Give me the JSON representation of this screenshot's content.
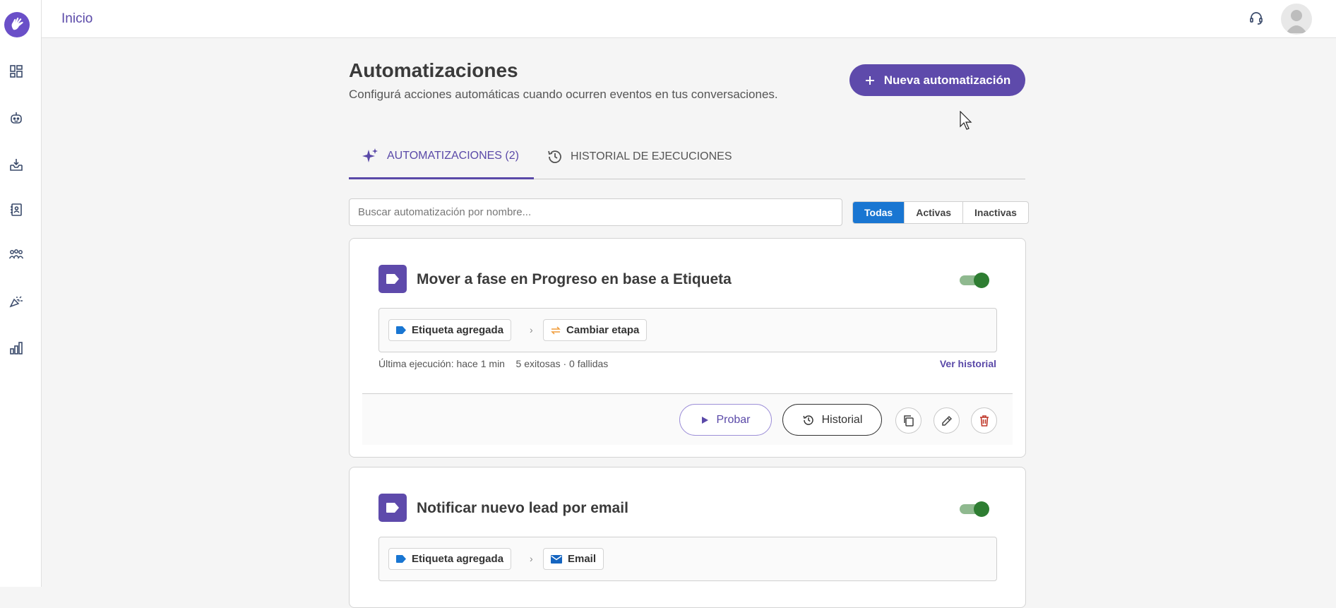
{
  "app": {
    "brand_color": "#5e4aab",
    "nav_icons": [
      "dashboard-icon",
      "bot-icon",
      "inbox-icon",
      "contacts-book-icon",
      "team-icon",
      "campaigns-icon",
      "analytics-icon"
    ]
  },
  "topbar": {
    "breadcrumb": "Inicio",
    "support_icon": "headset-icon",
    "avatar_icon": "user-avatar-icon"
  },
  "page": {
    "title": "Automatizaciones",
    "subtitle": "Configurá acciones automáticas cuando ocurren eventos en tus conversaciones.",
    "new_button_label": "Nueva automatización"
  },
  "tabs": [
    {
      "label": "AUTOMATIZACIONES (2)",
      "icon": "sparkle-icon",
      "active": true
    },
    {
      "label": "HISTORIAL DE EJECUCIONES",
      "icon": "history-icon",
      "active": false
    }
  ],
  "search": {
    "placeholder": "Buscar automatización por nombre...",
    "value": ""
  },
  "filters": [
    {
      "label": "Todas",
      "active": true
    },
    {
      "label": "Activas",
      "active": false
    },
    {
      "label": "Inactivas",
      "active": false
    }
  ],
  "automations": [
    {
      "title": "Mover a fase en Progreso en base a Etiqueta",
      "enabled": true,
      "trigger": {
        "label": "Etiqueta agregada",
        "icon": "tag-icon"
      },
      "action": {
        "label": "Cambiar etapa",
        "icon": "swap-arrows-icon"
      },
      "last_run": "Última ejecución: hace 1 min",
      "stats": "5 exitosas · 0 fallidas",
      "history_link": "Ver historial",
      "test_label": "Probar",
      "history_label": "Historial"
    },
    {
      "title": "Notificar nuevo lead por email",
      "enabled": true,
      "trigger": {
        "label": "Etiqueta agregada",
        "icon": "tag-icon"
      },
      "action": {
        "label": "Email",
        "icon": "mail-icon"
      }
    }
  ]
}
